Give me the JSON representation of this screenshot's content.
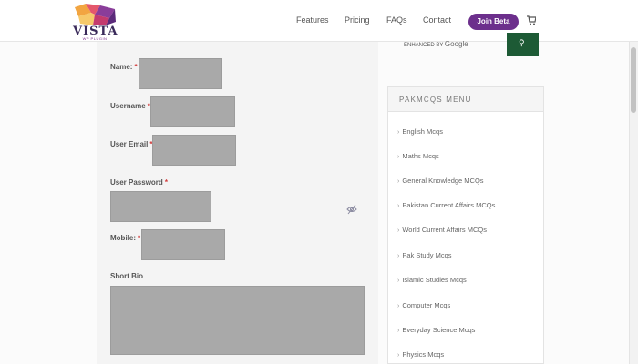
{
  "header": {
    "logo": {
      "wordmark": "VISTA",
      "tagline": "WP PLUGIN"
    },
    "nav": [
      {
        "label": "Features"
      },
      {
        "label": "Pricing"
      },
      {
        "label": "FAQs"
      },
      {
        "label": "Contact"
      }
    ],
    "join_label": "Join Beta",
    "cart_icon": "cart-icon"
  },
  "form": {
    "name_label": "Name:",
    "username_label": "Username",
    "email_label": "User Email",
    "password_label": "User Password",
    "mobile_label": "Mobile:",
    "bio_label": "Short Bio",
    "required_mark": "*",
    "password_toggle_icon": "eye-slash-icon"
  },
  "search": {
    "enhanced_by": "ENHANCED BY",
    "google": "Google",
    "button_icon": "search-icon",
    "button_color": "#1d5a35"
  },
  "menu": {
    "title": "PAKMCQS MENU",
    "items": [
      {
        "label": "English Mcqs"
      },
      {
        "label": "Maths Mcqs"
      },
      {
        "label": "General Knowledge MCQs"
      },
      {
        "label": "Pakistan Current Affairs MCQs"
      },
      {
        "label": "World Current Affairs MCQs"
      },
      {
        "label": "Pak Study Mcqs"
      },
      {
        "label": "Islamic Studies Mcqs"
      },
      {
        "label": "Computer Mcqs"
      },
      {
        "label": "Everyday Science Mcqs"
      },
      {
        "label": "Physics Mcqs"
      }
    ]
  },
  "colors": {
    "accent": "#6c2f8c",
    "required": "#d23a3a",
    "field_fill": "#a9a9a9"
  }
}
